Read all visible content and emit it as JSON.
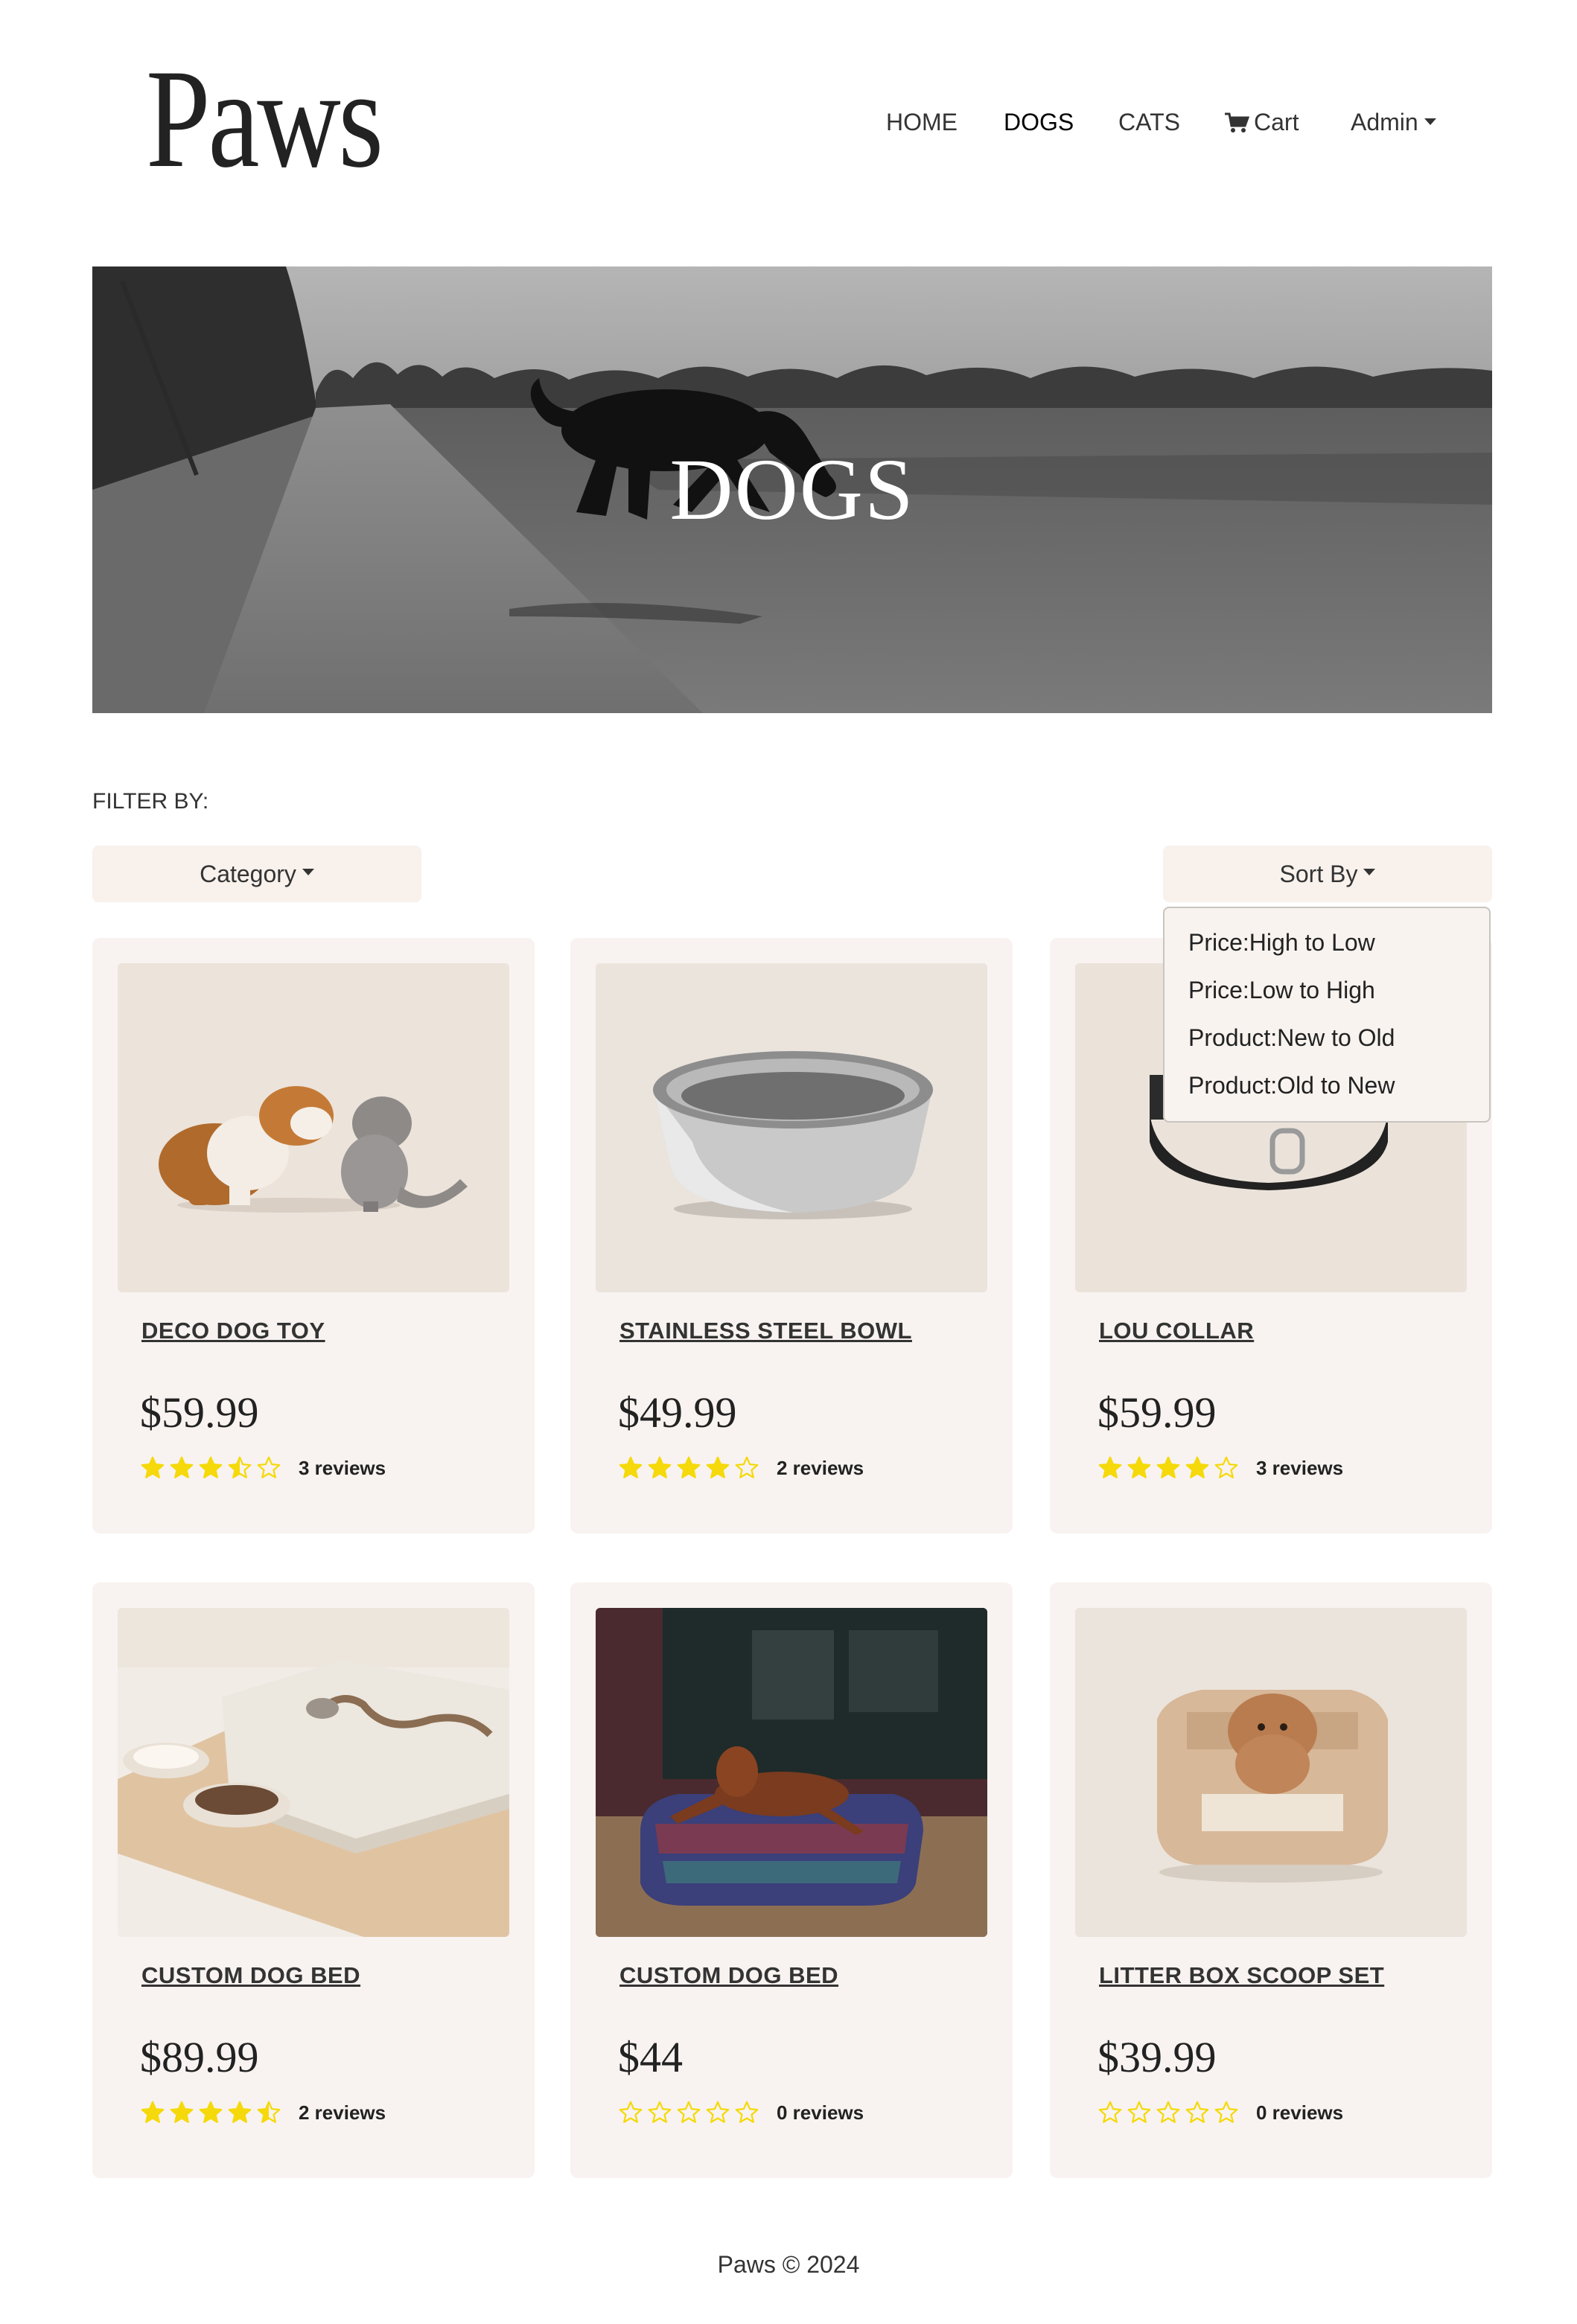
{
  "brand": {
    "logo": "Paws"
  },
  "nav": {
    "items": [
      {
        "label": "HOME",
        "active": false
      },
      {
        "label": "DOGS",
        "active": true
      },
      {
        "label": "CATS",
        "active": false
      },
      {
        "label": "Cart",
        "active": false,
        "icon": "cart-icon"
      },
      {
        "label": "Admin",
        "active": false,
        "dropdown": true
      }
    ]
  },
  "hero": {
    "title": "DOGS"
  },
  "filter": {
    "label": "FILTER BY:",
    "category_label": "Category",
    "sort_label": "Sort By",
    "sort_options": [
      "Price:High to Low",
      "Price:Low to High",
      "Product:New to Old",
      "Product:Old to New"
    ]
  },
  "products": [
    {
      "title": "DECO DOG TOY",
      "price": "$59.99",
      "rating": 3.5,
      "reviews": "3 reviews",
      "image": "bulldog-with-elephant-toy"
    },
    {
      "title": "STAINLESS STEEL BOWL",
      "price": "$49.99",
      "rating": 4,
      "reviews": "2 reviews",
      "image": "steel-bowl"
    },
    {
      "title": "LOU COLLAR",
      "price": "$59.99",
      "rating": 4,
      "reviews": "3 reviews",
      "image": "black-collar"
    },
    {
      "title": "CUSTOM DOG BED",
      "price": "$89.99",
      "rating": 4.5,
      "reviews": "2 reviews",
      "image": "wooden-bed-with-bowls"
    },
    {
      "title": "CUSTOM DOG BED",
      "price": "$44",
      "rating": 0,
      "reviews": "0 reviews",
      "image": "dog-on-cushion-bed"
    },
    {
      "title": "LITTER BOX SCOOP SET",
      "price": "$39.99",
      "rating": 0,
      "reviews": "0 reviews",
      "image": "puppy-in-basket"
    }
  ],
  "footer": {
    "text": "Paws © 2024"
  },
  "colors": {
    "card_bg": "#f8f3f0",
    "star": "#f5d90a",
    "text": "#222222"
  }
}
